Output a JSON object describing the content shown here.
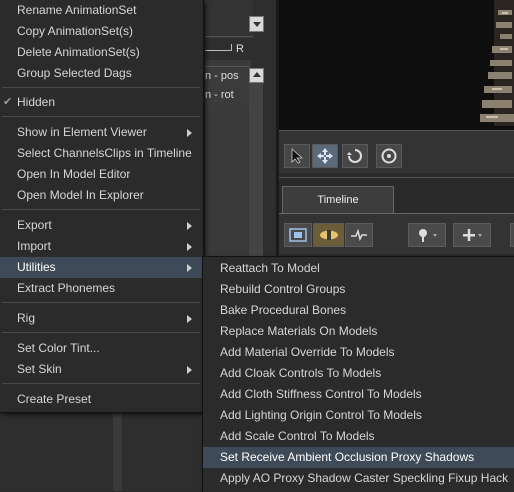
{
  "menu": {
    "items": [
      {
        "label": "Rename AnimationSet"
      },
      {
        "label": "Copy AnimationSet(s)"
      },
      {
        "label": "Delete AnimationSet(s)"
      },
      {
        "label": "Group Selected Dags"
      },
      {
        "label": "Hidden"
      },
      {
        "label": "Show in Element Viewer"
      },
      {
        "label": "Select ChannelsClips in Timeline"
      },
      {
        "label": "Open In Model Editor"
      },
      {
        "label": "Open Model In Explorer"
      },
      {
        "label": "Export"
      },
      {
        "label": "Import"
      },
      {
        "label": "Utilities"
      },
      {
        "label": "Extract Phonemes"
      },
      {
        "label": "Rig"
      },
      {
        "label": "Set Color Tint..."
      },
      {
        "label": "Set Skin"
      },
      {
        "label": "Create Preset"
      }
    ]
  },
  "submenu": {
    "items": [
      {
        "label": "Reattach To Model"
      },
      {
        "label": "Rebuild Control Groups"
      },
      {
        "label": "Bake Procedural Bones"
      },
      {
        "label": "Replace Materials On Models"
      },
      {
        "label": "Add Material Override To Models"
      },
      {
        "label": "Add Cloak Controls To Models"
      },
      {
        "label": "Add Cloth Stiffness Control To Models"
      },
      {
        "label": "Add Lighting Origin Control To Models"
      },
      {
        "label": "Add Scale Control To Models"
      },
      {
        "label": "Set Receive Ambient Occlusion Proxy Shadows"
      },
      {
        "label": "Apply AO Proxy Shadow Caster Speckling Fixup Hack"
      }
    ]
  },
  "background": {
    "slider_label": "R",
    "list_items": [
      {
        "label": "n - pos"
      },
      {
        "label": "n - rot"
      }
    ],
    "timeline_tab": "Timeline"
  },
  "colors": {
    "menu_bg": "#2b2b2b",
    "highlight": "#3e4a58",
    "text": "#d6d6d6"
  }
}
